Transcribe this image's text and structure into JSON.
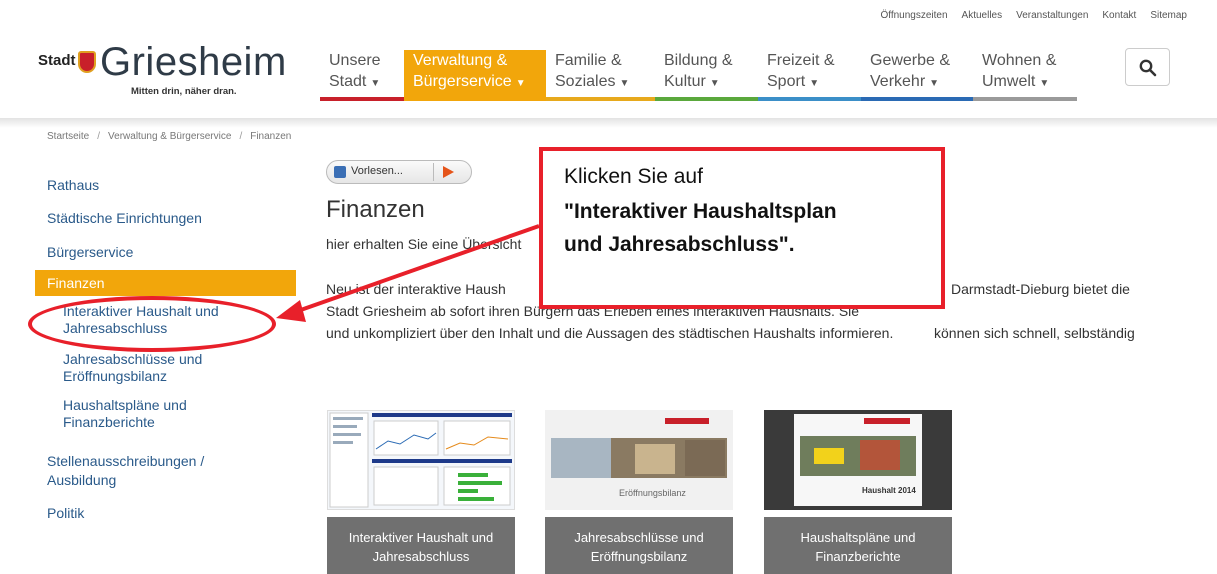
{
  "top_links": [
    "Öffnungszeiten",
    "Aktuelles",
    "Veranstaltungen",
    "Kontakt",
    "Sitemap"
  ],
  "logo": {
    "prefix": "Stadt",
    "name": "Griesheim",
    "tagline": "Mitten drin, näher dran."
  },
  "nav": [
    {
      "line1": "Unsere",
      "line2": "Stadt",
      "color": "#c8202a",
      "active": false
    },
    {
      "line1": "Verwaltung &",
      "line2": "Bürgerservice",
      "color": "#f2a60b",
      "active": true
    },
    {
      "line1": "Familie &",
      "line2": "Soziales",
      "color": "#e7a91c",
      "active": false
    },
    {
      "line1": "Bildung &",
      "line2": "Kultur",
      "color": "#5aa83c",
      "active": false
    },
    {
      "line1": "Freizeit &",
      "line2": "Sport",
      "color": "#3b8fc8",
      "active": false
    },
    {
      "line1": "Gewerbe &",
      "line2": "Verkehr",
      "color": "#2a6ab4",
      "active": false
    },
    {
      "line1": "Wohnen &",
      "line2": "Umwelt",
      "color": "#9a9a9a",
      "active": false
    }
  ],
  "breadcrumb": [
    "Startseite",
    "Verwaltung & Bürgerservice",
    "Finanzen"
  ],
  "sidebar": {
    "items": [
      "Rathaus",
      "Städtische Einrichtungen",
      "Bürgerservice"
    ],
    "active": "Finanzen",
    "sub": [
      {
        "l1": "Interaktiver Haushalt und",
        "l2": "Jahresabschluss"
      },
      {
        "l1": "Jahresabschlüsse und",
        "l2": "Eröffnungsbilanz"
      },
      {
        "l1": "Haushaltspläne und",
        "l2": "Finanzberichte"
      }
    ],
    "after": [
      {
        "l1": "Stellenausschreibungen /",
        "l2": "Ausbildung"
      },
      {
        "l1": "Politik",
        "l2": ""
      }
    ]
  },
  "content": {
    "vorlesen": "Vorlesen...",
    "title": "Finanzen",
    "intro": "hier erhalten Sie eine Übersicht",
    "p1_left": "Neu ist der interaktive Haush",
    "p1_right": "Darmstadt-Dieburg bietet die",
    "p2_left": "Stadt Griesheim ab sofort ihren Bürgern das Erleben eines interaktiven Haushalts. Sie",
    "p2_right": "können sich schnell, selbständig",
    "p3": "und unkompliziert über den Inhalt und die Aussagen des städtischen Haushalts informieren."
  },
  "callout": {
    "line1": "Klicken Sie auf",
    "line2": "\"Interaktiver Haushaltsplan",
    "line3": "und Jahresabschluss\".",
    "color": "#e8202a"
  },
  "tiles": [
    {
      "l1": "Interaktiver Haushalt und",
      "l2": "Jahresabschluss"
    },
    {
      "l1": "Jahresabschlüsse und",
      "l2": "Eröffnungsbilanz",
      "img_caption": "Eröffnungsbilanz"
    },
    {
      "l1": "Haushaltspläne und",
      "l2": "Finanzberichte",
      "img_caption": "Haushalt 2014"
    }
  ]
}
